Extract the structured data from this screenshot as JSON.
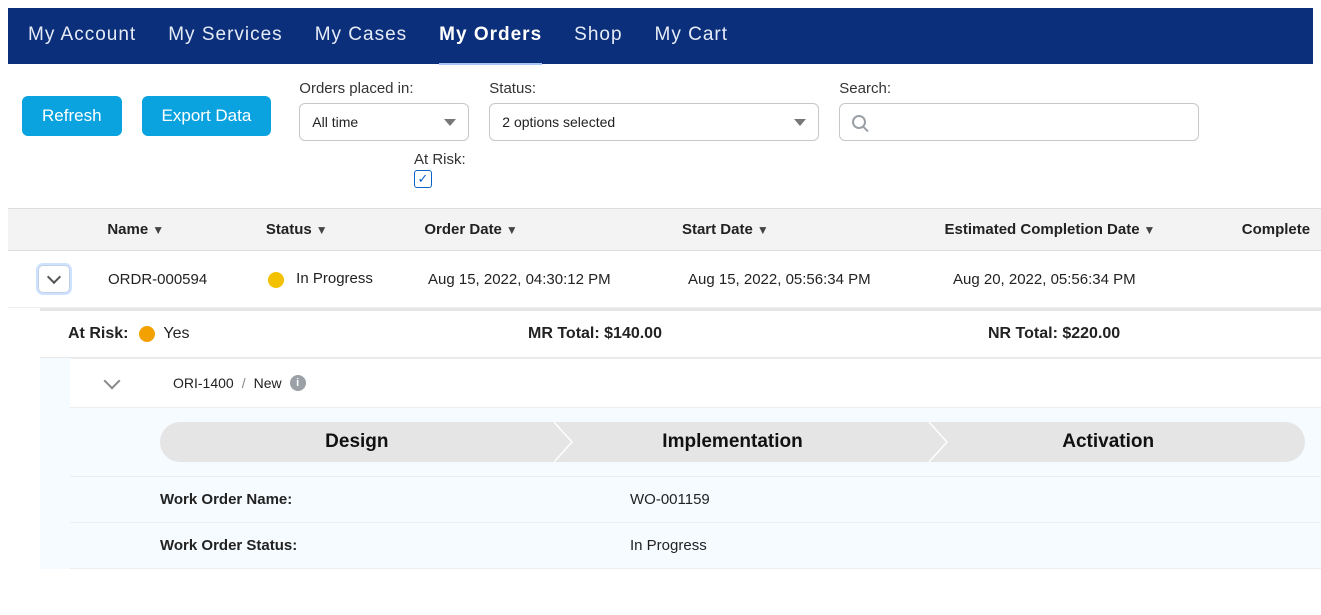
{
  "nav": {
    "items": [
      "My Account",
      "My Services",
      "My Cases",
      "My Orders",
      "Shop",
      "My Cart"
    ],
    "active_index": 3
  },
  "buttons": {
    "refresh": "Refresh",
    "export": "Export Data"
  },
  "filters": {
    "orders_placed_label": "Orders placed in:",
    "orders_placed_value": "All time",
    "status_label": "Status:",
    "status_value": "2 options selected",
    "search_label": "Search:",
    "search_value": "",
    "atrisk_label": "At Risk:",
    "atrisk_checked": true
  },
  "table": {
    "headers": {
      "name": "Name",
      "status": "Status",
      "order_date": "Order Date",
      "start_date": "Start Date",
      "ecd": "Estimated Completion Date",
      "complete": "Complete"
    },
    "row": {
      "name": "ORDR-000594",
      "status_text": "In Progress",
      "status_color": "#f2c200",
      "order_date": "Aug 15, 2022, 04:30:12 PM",
      "start_date": "Aug 15, 2022, 05:56:34 PM",
      "ecd": "Aug 20, 2022, 05:56:34 PM"
    }
  },
  "summary": {
    "atrisk_label": "At Risk:",
    "atrisk_value": "Yes",
    "atrisk_dot_color": "#f2a100",
    "mr_label": "MR Total: ",
    "mr_value": "$140.00",
    "nr_label": "NR Total: ",
    "nr_value": "$220.00"
  },
  "order_item": {
    "id": "ORI-1400",
    "status": "New"
  },
  "stages": [
    "Design",
    "Implementation",
    "Activation"
  ],
  "work_order": {
    "name_label": "Work Order Name:",
    "name_value": "WO-001159",
    "status_label": "Work Order Status:",
    "status_value": "In Progress"
  }
}
